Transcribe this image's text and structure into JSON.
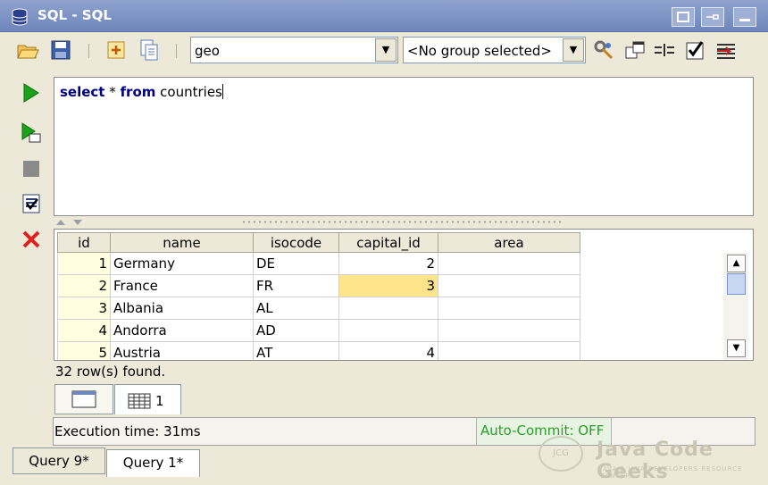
{
  "window": {
    "title": "SQL - SQL"
  },
  "toolbar": {
    "connection_value": "geo",
    "group_value": "<No group selected>"
  },
  "editor": {
    "keyword_select": "select",
    "star": " * ",
    "keyword_from": "from",
    "table_name": " countries"
  },
  "results": {
    "columns": [
      "id",
      "name",
      "isocode",
      "capital_id",
      "area"
    ],
    "rows": [
      {
        "id": "1",
        "name": "Germany",
        "isocode": "DE",
        "capital_id": "2",
        "area": ""
      },
      {
        "id": "2",
        "name": "France",
        "isocode": "FR",
        "capital_id": "3",
        "area": ""
      },
      {
        "id": "3",
        "name": "Albania",
        "isocode": "AL",
        "capital_id": "",
        "area": ""
      },
      {
        "id": "4",
        "name": "Andorra",
        "isocode": "AD",
        "capital_id": "",
        "area": ""
      },
      {
        "id": "5",
        "name": "Austria",
        "isocode": "AT",
        "capital_id": "4",
        "area": ""
      }
    ],
    "row_count_text": "32 row(s) found.",
    "highlight_color": "#fde38a"
  },
  "result_tabs": {
    "tab2_label": "1"
  },
  "status": {
    "execution_time": "Execution time: 31ms",
    "auto_commit": "Auto-Commit: OFF"
  },
  "query_tabs": [
    {
      "label": "Query 9*"
    },
    {
      "label": "Query 1*"
    }
  ],
  "watermark": {
    "logo_text": "JCG",
    "title": "Java Code Geeks",
    "subtitle": "JAVA 2 JAVA DEVELOPERS RESOURCE CENTER"
  },
  "icons": {
    "title": "database-icon",
    "open": "open-folder-icon",
    "save": "save-icon",
    "new": "new-query-icon",
    "copy": "copy-icon",
    "execute": "execute-icon",
    "execute_script": "execute-script-icon",
    "stop": "stop-icon",
    "commit": "commit-icon",
    "rollback": "rollback-icon"
  }
}
